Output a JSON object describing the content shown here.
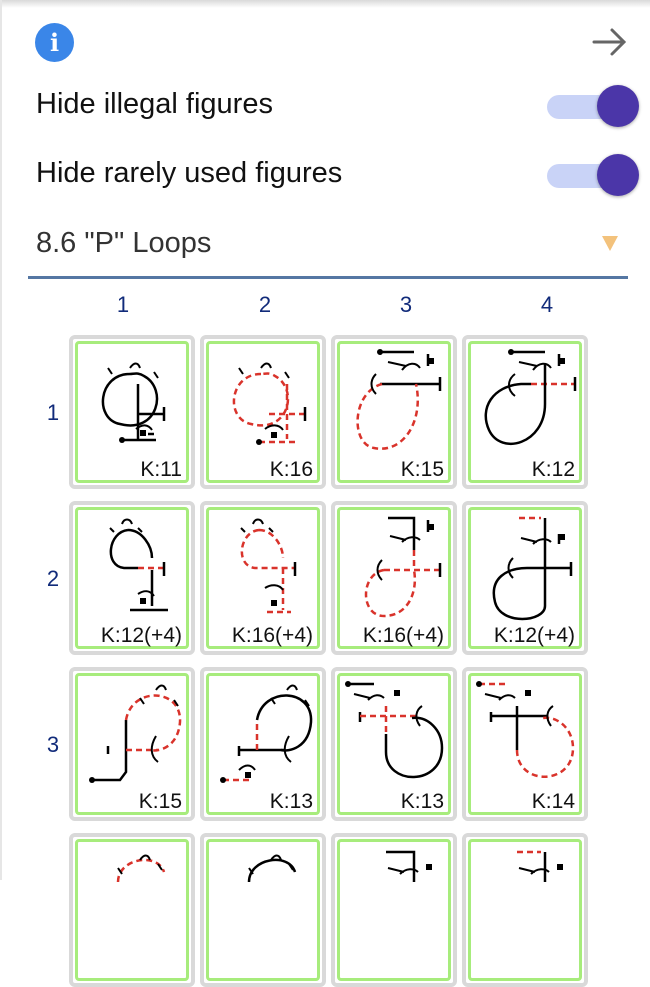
{
  "header": {
    "info_icon": "info-icon",
    "info_glyph": "i",
    "forward_icon": "arrow-right-icon"
  },
  "toggles": [
    {
      "label": "Hide illegal figures",
      "on": true
    },
    {
      "label": "Hide rarely used figures",
      "on": true
    }
  ],
  "category_select": {
    "value": "8.6 \"P\" Loops"
  },
  "grid": {
    "columns": [
      "1",
      "2",
      "3",
      "4"
    ],
    "rows": [
      "1",
      "2",
      "3"
    ],
    "cells": [
      [
        {
          "k": "K:11"
        },
        {
          "k": "K:16"
        },
        {
          "k": "K:15"
        },
        {
          "k": "K:12"
        }
      ],
      [
        {
          "k": "K:12(+4)"
        },
        {
          "k": "K:16(+4)"
        },
        {
          "k": "K:16(+4)"
        },
        {
          "k": "K:12(+4)"
        }
      ],
      [
        {
          "k": "K:15"
        },
        {
          "k": "K:13"
        },
        {
          "k": "K:13"
        },
        {
          "k": "K:14"
        }
      ]
    ]
  },
  "colors": {
    "accent": "#4b36a8",
    "track": "#c9d3f7",
    "cell_border": "#a7ec7c",
    "info": "#3a86e8",
    "negative_line": "#d9332b"
  }
}
